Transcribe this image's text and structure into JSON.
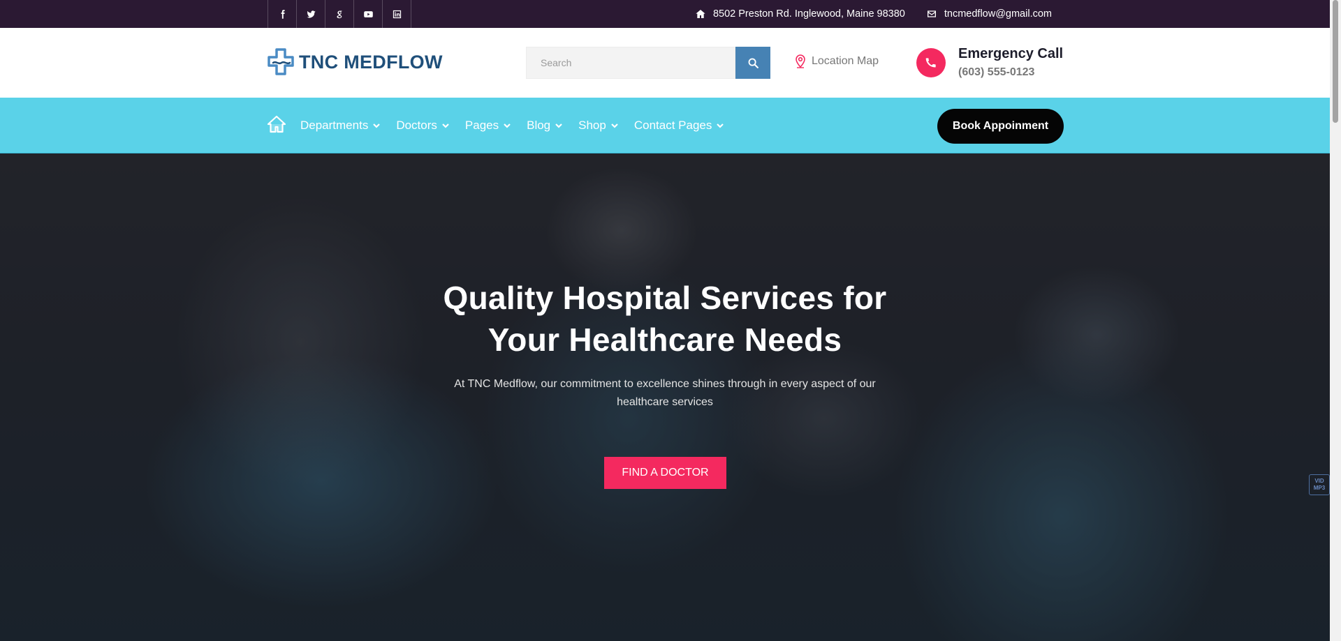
{
  "topbar": {
    "social": [
      {
        "name": "facebook-icon",
        "glyph": "f"
      },
      {
        "name": "twitter-icon",
        "glyph": ""
      },
      {
        "name": "google-icon",
        "glyph": "g"
      },
      {
        "name": "youtube-icon",
        "glyph": ""
      },
      {
        "name": "linkedin-icon",
        "glyph": ""
      }
    ],
    "address": "8502 Preston Rd. Inglewood, Maine 98380",
    "email": "tncmedflow@gmail.com"
  },
  "header": {
    "logo_text": "TNC MEDFLOW",
    "search_placeholder": "Search",
    "location_label": "Location Map",
    "emergency_title": "Emergency Call",
    "emergency_phone": "(603) 555-0123"
  },
  "nav": {
    "items": [
      {
        "label": "Departments"
      },
      {
        "label": "Doctors"
      },
      {
        "label": "Pages"
      },
      {
        "label": "Blog"
      },
      {
        "label": "Shop"
      },
      {
        "label": "Contact Pages"
      }
    ],
    "book_label": "Book Appoinment"
  },
  "hero": {
    "title_line1": "Quality Hospital Services for",
    "title_line2": "Your Healthcare Needs",
    "subtitle": "At TNC Medflow, our commitment to excellence shines through in every aspect of our healthcare services",
    "cta_label": "FIND A DOCTOR",
    "badge_line1": "VID",
    "badge_line2": "MP3"
  },
  "colors": {
    "topbar_bg": "#2b1933",
    "nav_bg": "#5ad2e8",
    "accent": "#f4295f",
    "brand_blue": "#1f4f7a",
    "search_button": "#4682b4"
  }
}
